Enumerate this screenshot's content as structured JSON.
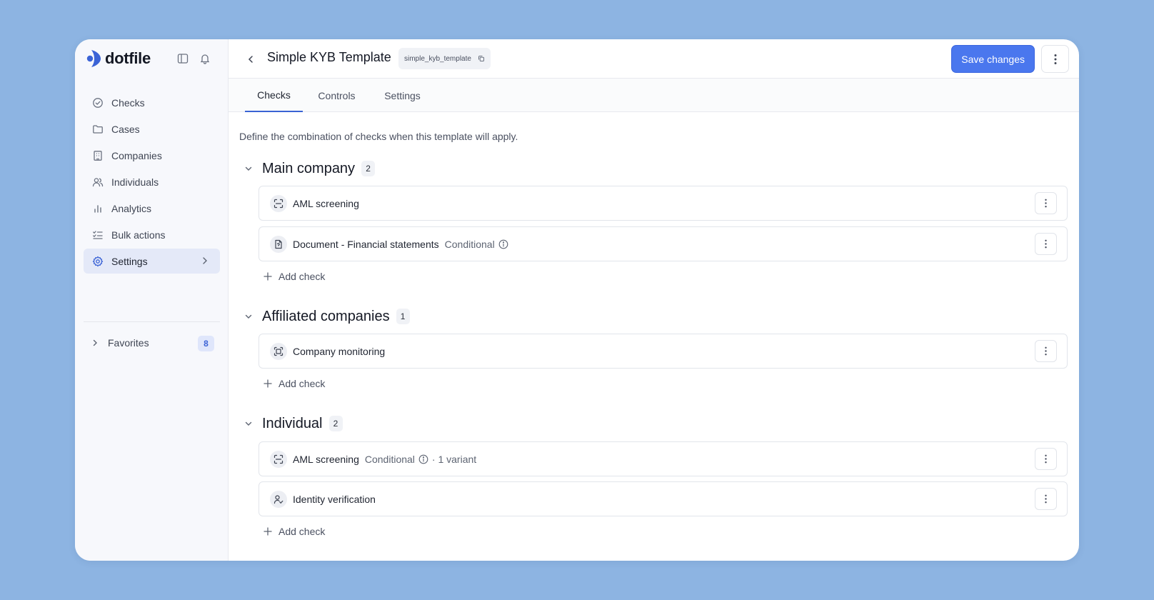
{
  "brand": {
    "name": "dotfile",
    "accent": "#3b63d6"
  },
  "sidebar": {
    "items": [
      {
        "label": "Checks",
        "icon": "check-circle-icon"
      },
      {
        "label": "Cases",
        "icon": "folder-icon"
      },
      {
        "label": "Companies",
        "icon": "building-icon"
      },
      {
        "label": "Individuals",
        "icon": "users-icon"
      },
      {
        "label": "Analytics",
        "icon": "bar-chart-icon"
      },
      {
        "label": "Bulk actions",
        "icon": "list-checks-icon"
      },
      {
        "label": "Settings",
        "icon": "gear-icon",
        "active": true
      }
    ],
    "favorites": {
      "label": "Favorites",
      "count": "8"
    }
  },
  "header": {
    "title": "Simple KYB Template",
    "slug": "simple_kyb_template",
    "save_label": "Save changes"
  },
  "tabs": [
    {
      "label": "Checks",
      "active": true
    },
    {
      "label": "Controls"
    },
    {
      "label": "Settings"
    }
  ],
  "intro": "Define the combination of checks when this template will apply.",
  "add_check_label": "Add check",
  "sections": [
    {
      "title": "Main company",
      "count": "2",
      "checks": [
        {
          "name": "AML screening",
          "icon": "scan-icon"
        },
        {
          "name": "Document - Financial statements",
          "icon": "document-icon",
          "conditional": "Conditional"
        }
      ]
    },
    {
      "title": "Affiliated companies",
      "count": "1",
      "checks": [
        {
          "name": "Company monitoring",
          "icon": "monitor-scan-icon"
        }
      ]
    },
    {
      "title": "Individual",
      "count": "2",
      "checks": [
        {
          "name": "AML screening",
          "icon": "scan-icon",
          "conditional": "Conditional",
          "variant": "· 1 variant"
        },
        {
          "name": "Identity verification",
          "icon": "user-check-icon"
        }
      ]
    }
  ]
}
